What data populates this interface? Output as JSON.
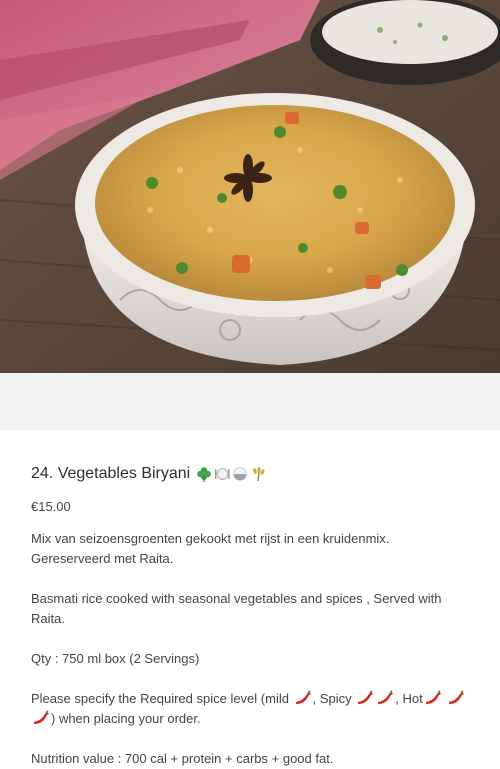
{
  "item": {
    "title": "24. Vegetables Biryani",
    "tags": [
      "clover-icon",
      "plate-icon",
      "rice-ball-icon",
      "grain-icon"
    ],
    "price": "€15.00",
    "description_nl": "Mix van seizoensgroenten gekookt met rijst in een kruidenmix. Gereserveerd met Raita.",
    "description_en": "Basmati rice cooked with seasonal vegetables and spices , Served with Raita.",
    "quantity": "Qty : 750 ml box (2 Servings)",
    "spice": {
      "prefix": "Please specify the Required spice level (mild",
      "spicy": ", Spicy",
      "hot": ", Hot",
      "suffix": ") when placing your order."
    },
    "nutrition": "Nutrition value : 700 cal + protein + carbs + good fat."
  },
  "image": {
    "alt": "vegetable biryani in a bowl"
  }
}
